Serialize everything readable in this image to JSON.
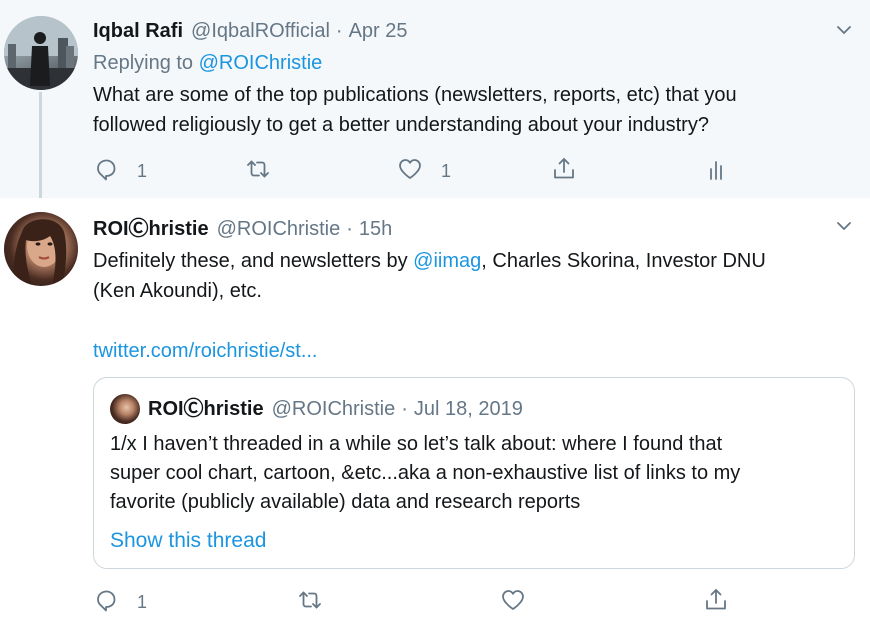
{
  "tweet1": {
    "name": "Iqbal Rafi",
    "handle": "@IqbalROfficial",
    "separator": "·",
    "time": "Apr 25",
    "replying_prefix": "Replying to",
    "replying_to": "@ROIChristie",
    "text_line1": "What are some of the top publications (newsletters, reports, etc) that you",
    "text_line2": "followed religiously to get a better understanding about your industry?",
    "reply_count": "1",
    "like_count": "1"
  },
  "tweet2": {
    "name": "ROIⒸhristie",
    "handle": "@ROIChristie",
    "separator": "·",
    "time": "15h",
    "text_line1_pre": "Definitely these, and newsletters by ",
    "text_mention": "@iimag",
    "text_line1_post": ", Charles Skorina, Investor DNU",
    "text_line2": "(Ken Akoundi), etc.",
    "link": "twitter.com/roichristie/st...",
    "reply_count": "1",
    "quote": {
      "name": "ROIⒸhristie",
      "handle": "@ROIChristie",
      "separator": "·",
      "time": "Jul 18, 2019",
      "text_line1": "1/x I haven’t threaded in a while so let’s talk about: where I found that",
      "text_line2": "super cool chart, cartoon, &etc...aka a non-exhaustive list of links to my",
      "text_line3": "favorite (publicly available) data and research reports",
      "show_thread": "Show this thread"
    }
  },
  "icons": {
    "reply": "reply-icon",
    "retweet": "retweet-icon",
    "like": "heart-icon",
    "share": "share-icon",
    "analytics": "analytics-icon",
    "caret": "chevron-down-icon"
  },
  "colors": {
    "link": "#1b95e0",
    "muted": "#657786",
    "text": "#14171a",
    "highlight_bg": "#f5f8fa",
    "border": "#ccd6dd"
  }
}
